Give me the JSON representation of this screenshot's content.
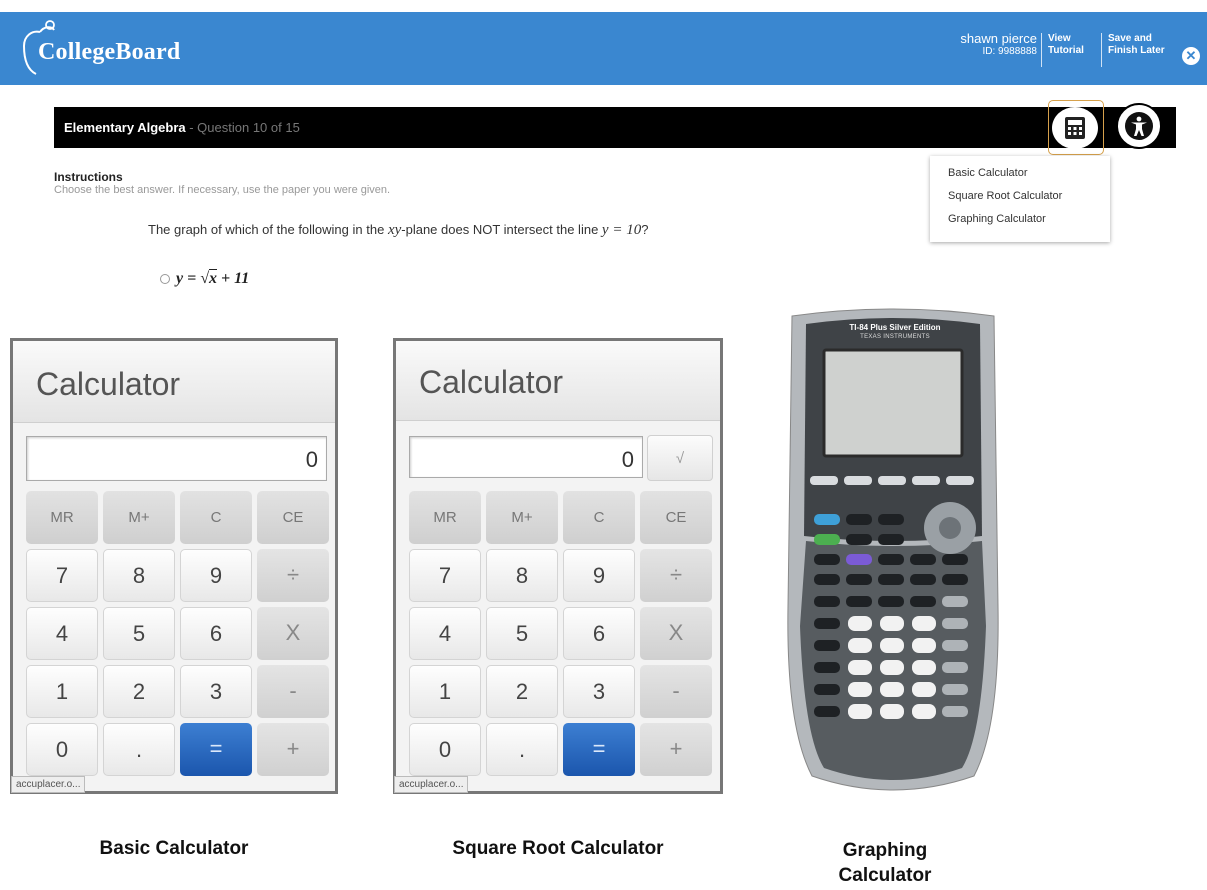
{
  "header": {
    "logo_text": "CollegeBoard",
    "user_name": "shawn pierce",
    "user_id": "ID: 9988888",
    "tutorial_line1": "View",
    "tutorial_line2": "Tutorial",
    "finish_line1": "Save and",
    "finish_line2": "Finish Later",
    "close_symbol": "✕",
    "colors": {
      "bar": "#3a87d0",
      "text": "#ffffff"
    }
  },
  "question_bar": {
    "subject": "Elementary Algebra",
    "question_count": " - Question 10 of 15",
    "calculator_icon": "calculator-icon",
    "accessibility_icon": "accessibility-icon"
  },
  "calculator_menu": {
    "items": [
      "Basic Calculator",
      "Square Root Calculator",
      "Graphing Calculator"
    ]
  },
  "instructions": {
    "title": "Instructions",
    "body": "Choose the best answer. If necessary, use the paper you were given."
  },
  "question": {
    "text_before": "The graph of which of the following in the ",
    "var_xy": "xy",
    "text_middle": "-plane does NOT intersect the line ",
    "line_eq": "y = 10",
    "text_after": "?"
  },
  "answer": {
    "prefix": "y = √",
    "radicand": "x",
    "suffix": " + 11"
  },
  "basic_calculator": {
    "title": "Calculator",
    "display": "0",
    "keys": [
      {
        "label": "MR",
        "type": "mem"
      },
      {
        "label": "M+",
        "type": "mem"
      },
      {
        "label": "C",
        "type": "mem"
      },
      {
        "label": "CE",
        "type": "mem"
      },
      {
        "label": "7",
        "type": "num"
      },
      {
        "label": "8",
        "type": "num"
      },
      {
        "label": "9",
        "type": "num"
      },
      {
        "label": "÷",
        "type": "op"
      },
      {
        "label": "4",
        "type": "num"
      },
      {
        "label": "5",
        "type": "num"
      },
      {
        "label": "6",
        "type": "num"
      },
      {
        "label": "X",
        "type": "op"
      },
      {
        "label": "1",
        "type": "num"
      },
      {
        "label": "2",
        "type": "num"
      },
      {
        "label": "3",
        "type": "num"
      },
      {
        "label": "-",
        "type": "op"
      },
      {
        "label": "0",
        "type": "num"
      },
      {
        "label": ".",
        "type": "num"
      },
      {
        "label": "=",
        "type": "eq"
      },
      {
        "label": "+",
        "type": "op"
      }
    ],
    "watermark": "accuplacer.o..."
  },
  "sqrt_calculator": {
    "title": "Calculator",
    "display": "0",
    "sqrt_key": "√",
    "watermark": "accuplacer.o..."
  },
  "graphing_calculator": {
    "model": "TI-84 Plus Silver Edition",
    "brand": "TEXAS INSTRUMENTS"
  },
  "captions": {
    "basic": "Basic Calculator",
    "sqrt": "Square Root Calculator",
    "graph_line1": "Graphing",
    "graph_line2": "Calculator"
  }
}
